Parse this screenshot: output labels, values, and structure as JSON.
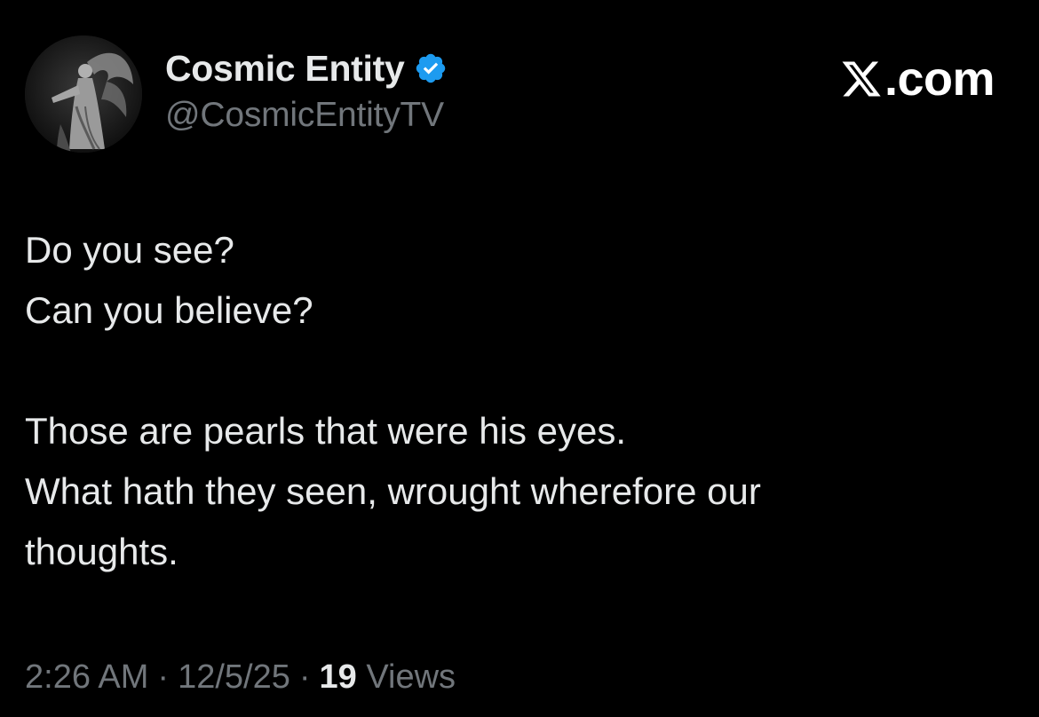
{
  "author": {
    "display_name": "Cosmic Entity",
    "handle": "@CosmicEntityTV",
    "verified": true,
    "verified_color": "#1d9bf0",
    "avatar_icon": "winged-angel-statue-avatar"
  },
  "site_mark": {
    "logo_icon": "x-logo-icon",
    "text": ".com"
  },
  "tweet": {
    "lines": [
      "Do you see?",
      "Can you believe?",
      "",
      "Those are pearls that were his eyes.",
      "What hath they seen, wrought wherefore our",
      "thoughts."
    ]
  },
  "meta": {
    "time": "2:26 AM",
    "separator": "·",
    "date": "12/5/25",
    "views_count": "19",
    "views_label": "Views"
  },
  "colors": {
    "background": "#000000",
    "primary_text": "#e7e9ea",
    "secondary_text": "#71767b",
    "accent": "#1d9bf0"
  }
}
